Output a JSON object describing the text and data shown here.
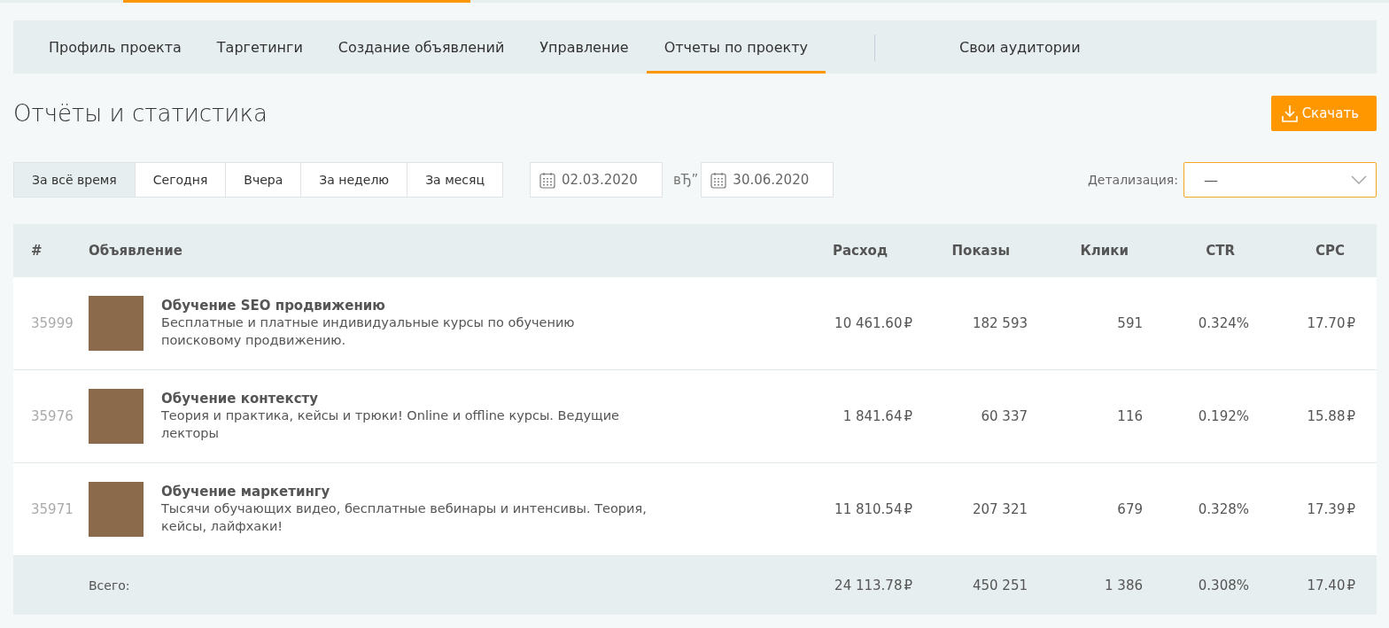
{
  "nav_tabs": [
    {
      "label": "Профиль проекта",
      "selected": false
    },
    {
      "label": "Таргетинги",
      "selected": false
    },
    {
      "label": "Создание объявлений",
      "selected": false
    },
    {
      "label": "Управление",
      "selected": false
    },
    {
      "label": "Отчеты по проекту",
      "selected": true
    }
  ],
  "extra_tab": {
    "label": "Свои аудитории",
    "selected": false
  },
  "page_title": "Отчёты и статистика",
  "download_button": "Скачать",
  "periods": [
    {
      "label": "За всё время",
      "selected": true
    },
    {
      "label": "Сегодня",
      "selected": false
    },
    {
      "label": "Вчера",
      "selected": false
    },
    {
      "label": "За неделю",
      "selected": false
    },
    {
      "label": "За месяц",
      "selected": false
    }
  ],
  "date_from": "02.03.2020",
  "date_separator": "вЂ”",
  "date_to": "30.06.2020",
  "detail": {
    "label": "Детализация:",
    "value": "—"
  },
  "table": {
    "columns": [
      "#",
      "Объявление",
      "Расход",
      "Показы",
      "Клики",
      "CTR",
      "CPC"
    ],
    "rows": [
      {
        "id": "35999",
        "title": "Обучение SEO продвижению",
        "description": "Бесплатные и платные индивидуальные курсы по обучению поисковому продвижению.",
        "spend": "10 461.60",
        "impressions": "182 593",
        "clicks": "591",
        "ctr": "0.324%",
        "cpc": "17.70"
      },
      {
        "id": "35976",
        "title": "Обучение контексту",
        "description": "Теория и практика, кейсы и трюки! Online и offline курсы. Ведущие лекторы",
        "spend": "1 841.64",
        "impressions": "60 337",
        "clicks": "116",
        "ctr": "0.192%",
        "cpc": "15.88"
      },
      {
        "id": "35971",
        "title": "Обучение маркетингу",
        "description": "Тысячи обучающих видео, бесплатные вебинары и интенсивы. Теория, кейсы, лайфхаки!",
        "spend": "11 810.54",
        "impressions": "207 321",
        "clicks": "679",
        "ctr": "0.328%",
        "cpc": "17.39"
      }
    ],
    "total": {
      "label": "Всего:",
      "spend": "24 113.78",
      "impressions": "450 251",
      "clicks": "1 386",
      "ctr": "0.308%",
      "cpc": "17.40"
    },
    "currency": "₽"
  }
}
